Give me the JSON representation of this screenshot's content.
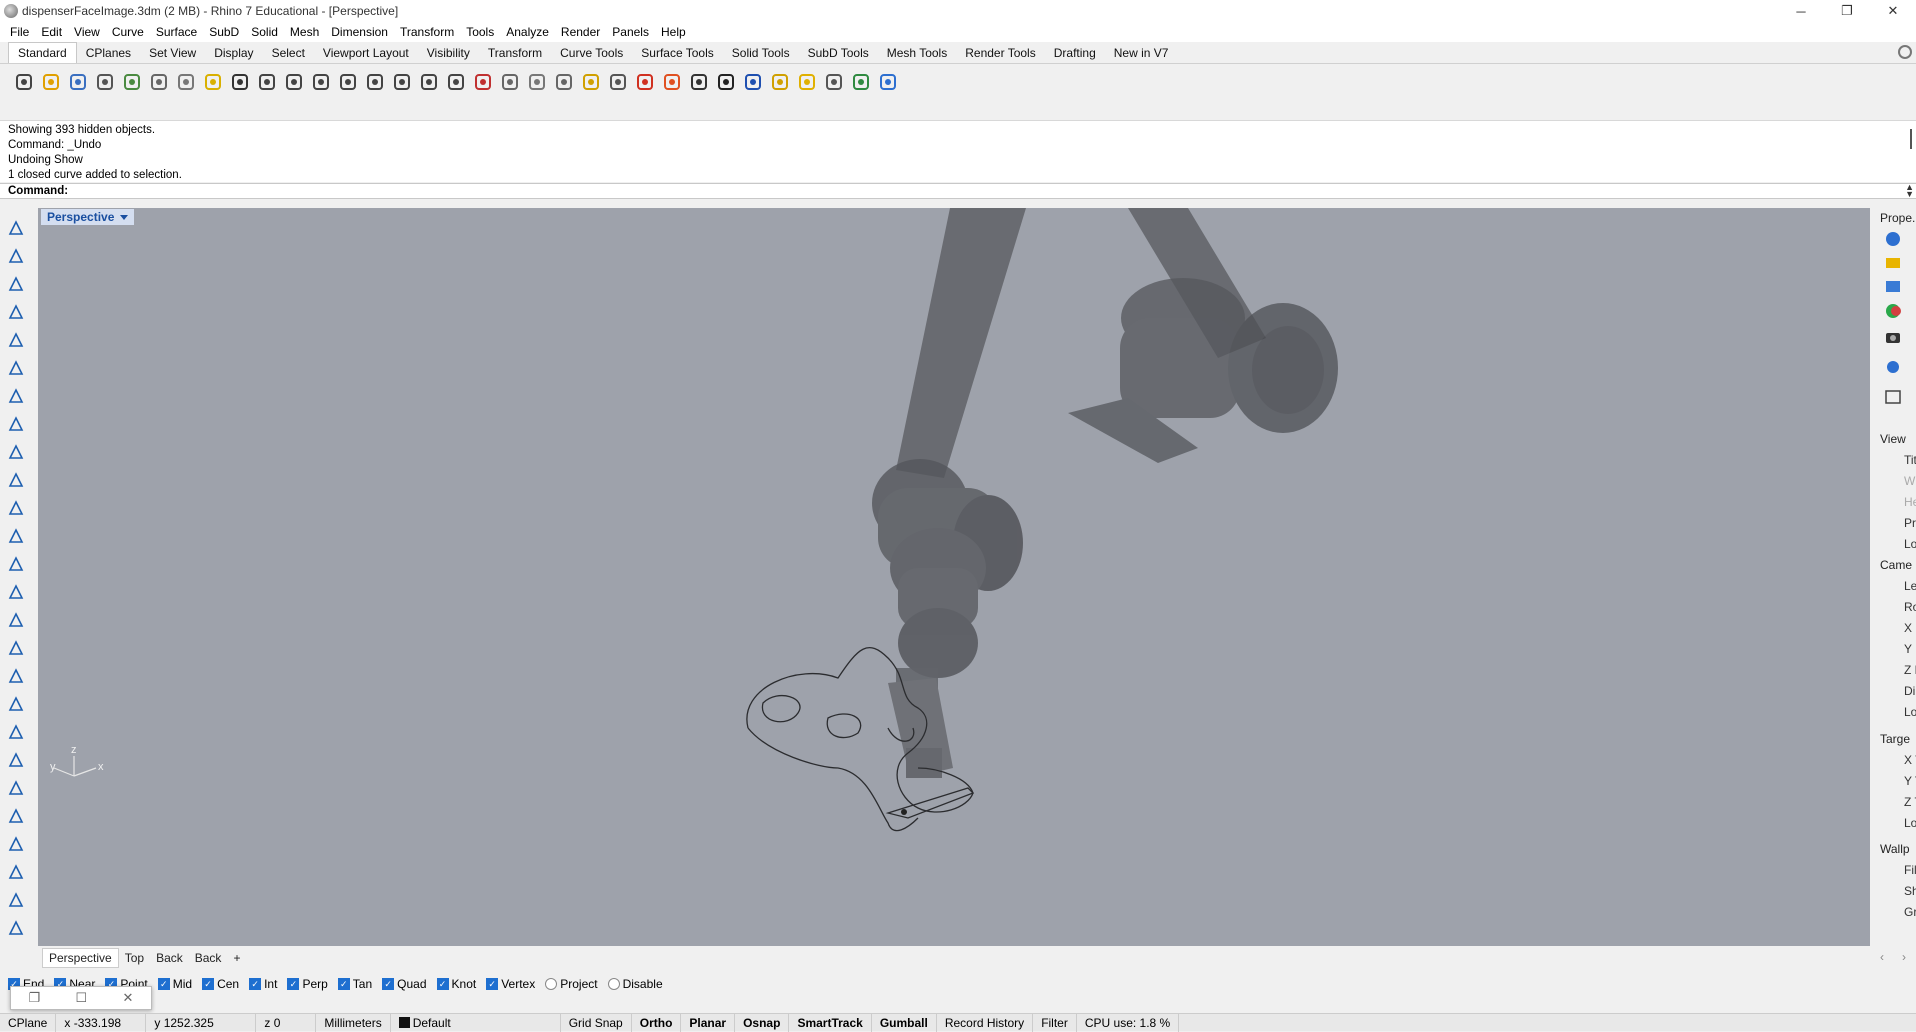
{
  "window": {
    "title": "dispenserFaceImage.3dm (2 MB) - Rhino 7 Educational - [Perspective]",
    "controls": [
      "─",
      "❐",
      "✕"
    ]
  },
  "menu": [
    "File",
    "Edit",
    "View",
    "Curve",
    "Surface",
    "SubD",
    "Solid",
    "Mesh",
    "Dimension",
    "Transform",
    "Tools",
    "Analyze",
    "Render",
    "Panels",
    "Help"
  ],
  "tabs": [
    "Standard",
    "CPlanes",
    "Set View",
    "Display",
    "Select",
    "Viewport Layout",
    "Visibility",
    "Transform",
    "Curve Tools",
    "Surface Tools",
    "Solid Tools",
    "SubD Tools",
    "Mesh Tools",
    "Render Tools",
    "Drafting",
    "New in V7"
  ],
  "toolbar_icons": [
    "new-icon",
    "open-icon",
    "save-icon",
    "print-icon",
    "import-icon",
    "cut-icon",
    "copy-icon",
    "paste-icon",
    "undo-icon",
    "pan-icon",
    "rotate-view-icon",
    "zoom-dynamic-icon",
    "zoom-window-icon",
    "zoom-extents-icon",
    "zoom-selected-icon",
    "undo-view-icon",
    "four-viewports-icon",
    "car-icon",
    "sketch-icon",
    "cplane-icon",
    "properties-icon",
    "light-icon",
    "lock-icon",
    "layer-icon",
    "color-icon",
    "material-icon",
    "shade-icon",
    "render-icon",
    "filter-icon",
    "options-icon",
    "dimension-icon",
    "globe-icon",
    "help-icon"
  ],
  "history": {
    "lines": [
      "Showing 393 hidden objects.",
      "Command: _Undo",
      "Undoing Show",
      "1 closed curve added to selection."
    ],
    "command_label": "Command:"
  },
  "viewport": {
    "label": "Perspective",
    "axis_labels": {
      "z": "z",
      "y": "y",
      "x": "x"
    },
    "bg": "#9ea2ab"
  },
  "viewport_tabs": [
    "Perspective",
    "Top",
    "Back",
    "Back"
  ],
  "osnap": {
    "items": [
      {
        "label": "End",
        "checked": true
      },
      {
        "label": "Near",
        "checked": true
      },
      {
        "label": "Point",
        "checked": true
      },
      {
        "label": "Mid",
        "checked": true
      },
      {
        "label": "Cen",
        "checked": true
      },
      {
        "label": "Int",
        "checked": true
      },
      {
        "label": "Perp",
        "checked": true
      },
      {
        "label": "Tan",
        "checked": true
      },
      {
        "label": "Quad",
        "checked": true
      },
      {
        "label": "Knot",
        "checked": true
      },
      {
        "label": "Vertex",
        "checked": true
      },
      {
        "label": "Project",
        "checked": false
      },
      {
        "label": "Disable",
        "checked": false
      }
    ]
  },
  "floating_dialog": {
    "buttons": [
      "❐",
      "☐",
      "✕"
    ]
  },
  "status": {
    "cplane": "CPlane",
    "x": "x -333.198",
    "y": "y 1252.325",
    "z": "z 0",
    "units": "Millimeters",
    "layer": "Default",
    "grid_snap": "Grid Snap",
    "ortho": "Ortho",
    "planar": "Planar",
    "osnap": "Osnap",
    "smarttrack": "SmartTrack",
    "gumball": "Gumball",
    "record_history": "Record History",
    "filter": "Filter",
    "cpu": "CPU use: 1.8 %"
  },
  "right_panel": {
    "title": "Prope...",
    "view_header": "View",
    "view_items": [
      "Tit",
      "W",
      "He",
      "Pr",
      "Lo"
    ],
    "camera_header": "Came",
    "camera_items": [
      "Le",
      "Ro",
      "X L",
      "Y L",
      "Z L",
      "Di",
      "Lo"
    ],
    "target_header": "Targe",
    "target_items": [
      "X T",
      "Y T",
      "Z T",
      "Lo"
    ],
    "wallpaper_header": "Wallp",
    "wallpaper_items": [
      "Fil",
      "Sh",
      "Gr"
    ],
    "scroll_arrows": [
      "‹",
      "›"
    ]
  }
}
